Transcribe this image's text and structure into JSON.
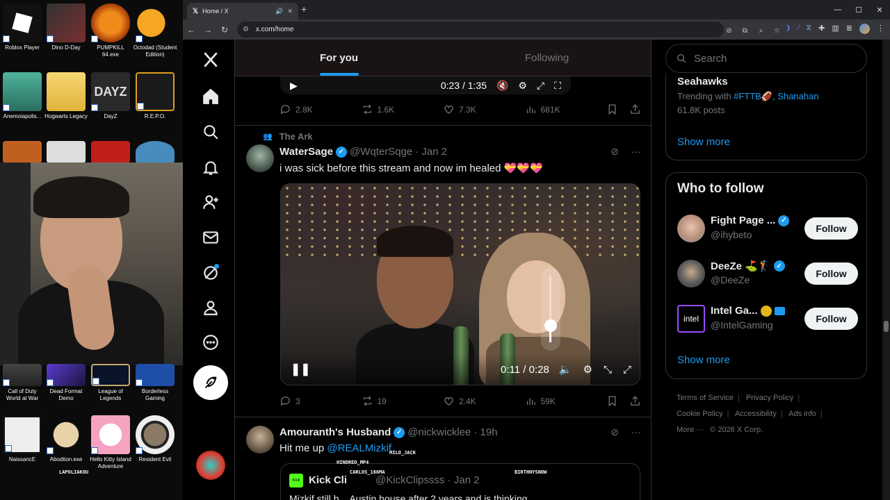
{
  "desktop": {
    "icons": [
      {
        "label": "Roblox Player"
      },
      {
        "label": "Dino D-Day"
      },
      {
        "label": "PUMPKILL 64.exe"
      },
      {
        "label": "Octodad (Student Edition)"
      },
      {
        "label": "Anemoiapolis..."
      },
      {
        "label": "Hogwarts Legacy"
      },
      {
        "label": "DayZ"
      },
      {
        "label": "R.E.P.O."
      },
      {
        "label": "Call of Duty World at War"
      },
      {
        "label": "Dead Format Demo"
      },
      {
        "label": "League of Legends"
      },
      {
        "label": "Borderless Gaming"
      },
      {
        "label": "NaissancE"
      },
      {
        "label": "Abodtion.exe"
      },
      {
        "label": "Hello Kitty Island Adventure"
      },
      {
        "label": "Resident Evil"
      }
    ]
  },
  "browser": {
    "tab_title": "Home / X",
    "url": "x.com/home"
  },
  "nav": {
    "items": [
      "x-logo-icon",
      "home-icon",
      "search-icon",
      "notifications-icon",
      "communities-icon",
      "messages-icon",
      "grok-icon",
      "profile-icon",
      "more-icon"
    ]
  },
  "feed": {
    "tabs": [
      {
        "label": "For you",
        "active": true
      },
      {
        "label": "Following",
        "active": false
      }
    ],
    "prev_video": {
      "time": "0:23 / 1:35"
    },
    "prev_actions": {
      "replies": "2.8K",
      "reposts": "1.6K",
      "likes": "7.3K",
      "views": "681K"
    },
    "tweet1": {
      "context": "The Ark",
      "name": "WaterSage",
      "handle": "@WqterSqge",
      "date": "· Jan 2",
      "text": "i was sick before this stream and now im healed 💝💝💝",
      "video_time": "0:11 / 0:28",
      "volume": 0.25,
      "actions": {
        "replies": "3",
        "reposts": "19",
        "likes": "2.4K",
        "views": "59K"
      }
    },
    "tweet2": {
      "name": "Amouranth's Husband",
      "handle": "@nickwicklee",
      "date": "· 19h",
      "text_prefix": "Hit me up ",
      "mention": "@REALMizkif",
      "quote_name": "Kick Cli",
      "quote_handle": "@KickClipssss · Jan 2",
      "quote_text": "Mizkif still b... Austin house after 2 years and is thinking"
    }
  },
  "sidebar": {
    "search_placeholder": "Search",
    "trend": {
      "title": "Seahawks",
      "sub_prefix": "Trending with ",
      "sub_links": "#FTTB🏈, Shanahan",
      "posts": "61.8K posts"
    },
    "show_more": "Show more",
    "who_to_follow": "Who to follow",
    "follow_list": [
      {
        "name": "Fight Page ...",
        "handle": "@ihybeto",
        "button": "Follow"
      },
      {
        "name": "DeeZe ⛳🏌️",
        "handle": "@DeeZe",
        "button": "Follow"
      },
      {
        "name": "Intel Ga... ",
        "handle": "@IntelGaming",
        "button": "Follow"
      }
    ],
    "show_more_2": "Show more",
    "footer": {
      "terms": "Terms of Service",
      "privacy": "Privacy Policy",
      "cookie": "Cookie Policy",
      "accessibility": "Accessibility",
      "ads": "Ads info",
      "more": "More ···",
      "copyright": "© 2026 X Corp."
    }
  },
  "stream_overlays": {
    "names": [
      "HINDRED_MP4",
      "MILO_JACK",
      "CARLOS_166MA",
      "BIRTHNYSNOW",
      "LAPOLIAKOU"
    ]
  }
}
